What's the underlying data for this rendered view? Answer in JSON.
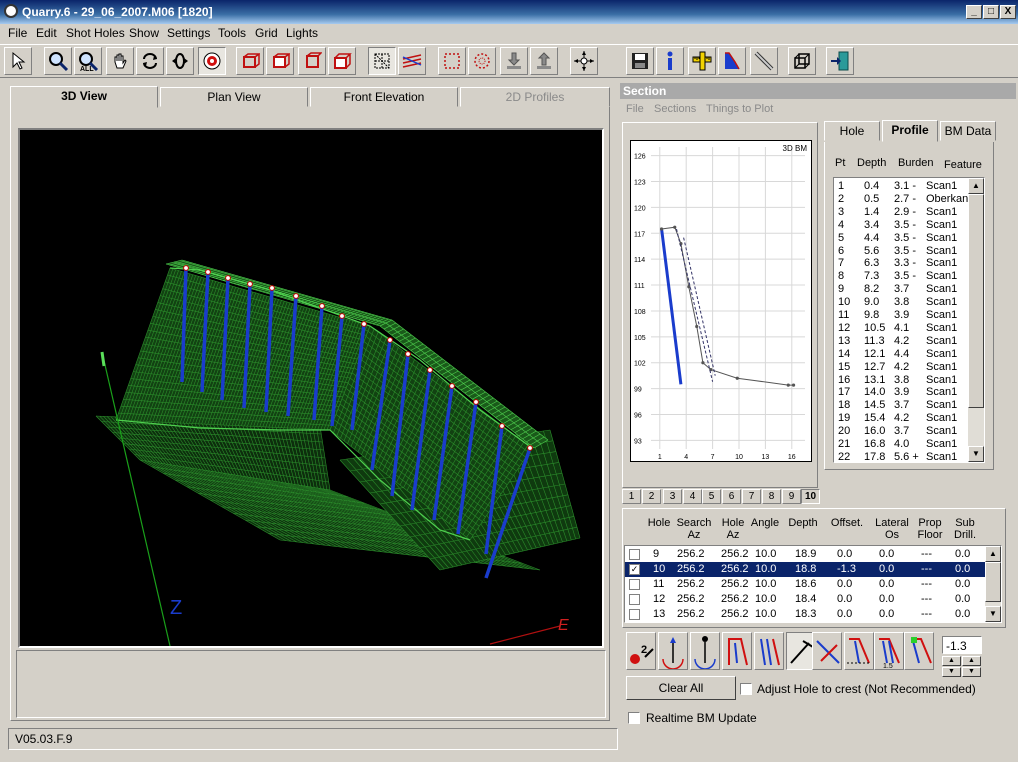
{
  "window": {
    "title": "Quarry.6 - 29_06_2007.M06 [1820]",
    "controls": [
      "_",
      "□",
      "X"
    ]
  },
  "menu": [
    "File",
    "Edit",
    "Shot Holes",
    "Show",
    "Settings",
    "Tools",
    "Grid",
    "Lights"
  ],
  "toolbar_icons": [
    "pointer-icon",
    "zoom-icon",
    "zoom-all-icon",
    "pan-hand-icon",
    "rotate-icon",
    "orbit-icon",
    "target-icon",
    "box-front-icon",
    "box-side-icon",
    "box-top-icon",
    "box-iso-icon",
    "select-grid-icon",
    "hatch-icon",
    "select-rect-icon",
    "circle-dots-icon",
    "download-icon",
    "upload-icon",
    "crosshair-icon",
    "save-icon",
    "info-icon",
    "ruler-icon",
    "profile-blue-icon",
    "pencil-icon",
    "cube-icon",
    "exit-icon"
  ],
  "view_tabs": [
    {
      "label": "3D View",
      "state": "active"
    },
    {
      "label": "Plan View",
      "state": "normal"
    },
    {
      "label": "Front Elevation",
      "state": "normal"
    },
    {
      "label": "2D Profiles",
      "state": "disabled"
    }
  ],
  "viewport": {
    "axis_z": "Z",
    "axis_e": "E"
  },
  "status": {
    "version": "V05.03.F.9"
  },
  "section_panel": {
    "title": "Section",
    "submenu": [
      "File",
      "Sections",
      "Things to Plot"
    ],
    "chart_label": "3D BM",
    "page_tabs": [
      "1",
      "2",
      "3",
      "4",
      "5",
      "6",
      "7",
      "8",
      "9",
      "10"
    ],
    "active_page": "10"
  },
  "chart_data": {
    "type": "line",
    "title": "3D BM",
    "xlabel": "",
    "ylabel": "",
    "x_ticks": [
      "1",
      "4",
      "7",
      "10",
      "13",
      "16"
    ],
    "y_ticks": [
      "126",
      "123",
      "120",
      "117",
      "114",
      "111",
      "108",
      "105",
      "102",
      "99",
      "96",
      "93"
    ],
    "xlim": [
      0,
      17.5
    ],
    "ylim": [
      92,
      127
    ],
    "series": [
      {
        "name": "",
        "color": "#1a3ccc",
        "points": [
          [
            1.2,
            117.5
          ],
          [
            3.4,
            99.5
          ]
        ]
      },
      {
        "name": "",
        "color": "#555555",
        "points": [
          [
            1.2,
            117.5
          ],
          [
            2.7,
            117.7
          ],
          [
            3.4,
            115.8
          ],
          [
            4.3,
            110.8
          ],
          [
            5.2,
            106.2
          ],
          [
            5.9,
            102.0
          ],
          [
            6.8,
            101.2
          ],
          [
            9.8,
            100.2
          ],
          [
            15.6,
            99.4
          ],
          [
            16.2,
            99.4
          ]
        ]
      },
      {
        "name": "",
        "color": "#333366",
        "dash": true,
        "points": [
          [
            2.9,
            117.5
          ],
          [
            7.0,
            99.8
          ]
        ]
      },
      {
        "name": "",
        "color": "#333366",
        "dash": true,
        "points": [
          [
            3.7,
            116.5
          ],
          [
            7.3,
            100.5
          ]
        ]
      }
    ]
  },
  "profile_tabs": [
    {
      "label": "Hole",
      "state": "normal"
    },
    {
      "label": "Profile",
      "state": "active"
    },
    {
      "label": "BM Data",
      "state": "normal"
    }
  ],
  "profile_columns": [
    "Pt",
    "Depth",
    "Burden",
    "Feature"
  ],
  "profile_rows": [
    [
      "1",
      "0.4",
      "3.1 -",
      "Scan1"
    ],
    [
      "2",
      "0.5",
      "2.7 -",
      "Oberkan"
    ],
    [
      "3",
      "1.4",
      "2.9 -",
      "Scan1"
    ],
    [
      "4",
      "3.4",
      "3.5 -",
      "Scan1"
    ],
    [
      "5",
      "4.4",
      "3.5 -",
      "Scan1"
    ],
    [
      "6",
      "5.6",
      "3.5 -",
      "Scan1"
    ],
    [
      "7",
      "6.3",
      "3.3 -",
      "Scan1"
    ],
    [
      "8",
      "7.3",
      "3.5 -",
      "Scan1"
    ],
    [
      "9",
      "8.2",
      "3.7",
      "Scan1"
    ],
    [
      "10",
      "9.0",
      "3.8",
      "Scan1"
    ],
    [
      "11",
      "9.8",
      "3.9",
      "Scan1"
    ],
    [
      "12",
      "10.5",
      "4.1",
      "Scan1"
    ],
    [
      "13",
      "11.3",
      "4.2",
      "Scan1"
    ],
    [
      "14",
      "12.1",
      "4.4",
      "Scan1"
    ],
    [
      "15",
      "12.7",
      "4.2",
      "Scan1"
    ],
    [
      "16",
      "13.1",
      "3.8",
      "Scan1"
    ],
    [
      "17",
      "14.0",
      "3.9",
      "Scan1"
    ],
    [
      "18",
      "14.5",
      "3.7",
      "Scan1"
    ],
    [
      "19",
      "15.4",
      "4.2",
      "Scan1"
    ],
    [
      "20",
      "16.0",
      "3.7",
      "Scan1"
    ],
    [
      "21",
      "16.8",
      "4.0",
      "Scan1"
    ],
    [
      "22",
      "17.8",
      "5.6 +",
      "Scan1"
    ]
  ],
  "hole_columns": [
    "Hole",
    "Search Az",
    "Hole Az",
    "Angle",
    "Depth",
    "Offset.",
    "Lateral Os",
    "Prop Floor",
    "Sub Drill."
  ],
  "hole_rows": [
    {
      "checked": false,
      "selected": false,
      "cells": [
        "9",
        "256.2",
        "256.2",
        "10.0",
        "18.9",
        "0.0",
        "0.0",
        "---",
        "0.0"
      ]
    },
    {
      "checked": true,
      "selected": true,
      "cells": [
        "10",
        "256.2",
        "256.2",
        "10.0",
        "18.8",
        "-1.3",
        "0.0",
        "---",
        "0.0"
      ]
    },
    {
      "checked": false,
      "selected": false,
      "cells": [
        "11",
        "256.2",
        "256.2",
        "10.0",
        "18.6",
        "0.0",
        "0.0",
        "---",
        "0.0"
      ]
    },
    {
      "checked": false,
      "selected": false,
      "cells": [
        "12",
        "256.2",
        "256.2",
        "10.0",
        "18.4",
        "0.0",
        "0.0",
        "---",
        "0.0"
      ]
    },
    {
      "checked": false,
      "selected": false,
      "cells": [
        "13",
        "256.2",
        "256.2",
        "10.0",
        "18.3",
        "0.0",
        "0.0",
        "---",
        "0.0"
      ]
    }
  ],
  "hole_tools": [
    "2-points-icon",
    "azimuth-up-icon",
    "azimuth-down-icon",
    "hole-angle-icon",
    "parallel-holes-icon",
    "drill-pick-icon",
    "line-cross-icon",
    "sub-drill-icon",
    "offset-1-5-icon",
    "green-hole-icon"
  ],
  "offset_value": "-1.3",
  "clear_all_label": "Clear All",
  "adjust_crest_label": "Adjust Hole to crest (Not Recommended)",
  "realtime_label": "Realtime BM Update",
  "colors": {
    "titlebar": "#0a246a",
    "selection": "#0a246a",
    "mesh": "#2a8a2a",
    "holes": "#1a3ccc"
  }
}
